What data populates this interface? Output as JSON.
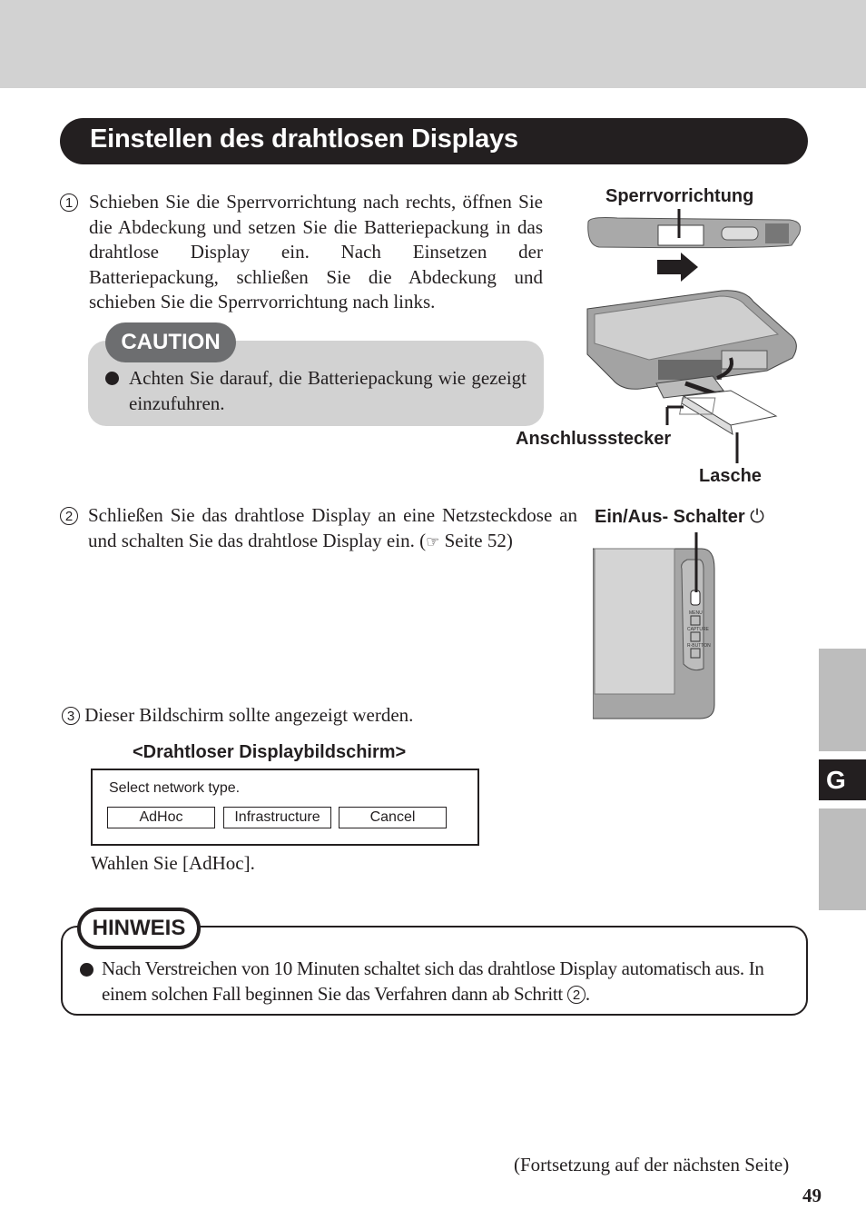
{
  "header": {
    "title": "Einstellen des drahtlosen Displays"
  },
  "steps": [
    {
      "number": "1",
      "text": "Schieben Sie die Sperrvorrichtung nach rechts, öffnen Sie die Abdeckung und setzen Sie die Batteriepackung in das drahtlose Display ein. Nach Einsetzen der Batteriepackung, schließen Sie die Abdeckung und schieben Sie die Sperrvorrichtung nach links."
    },
    {
      "number": "2",
      "text_before": "Schließen Sie das drahtlose Display an eine Netzsteckdose an und schalten Sie das drahtlose Display ein. (",
      "ref_icon": "pointing-hand-icon",
      "text_after": " Seite 52)"
    },
    {
      "number": "3",
      "text": "Dieser Bildschirm sollte angezeigt werden."
    }
  ],
  "caution": {
    "label": "CAUTION",
    "items": [
      "Achten Sie darauf, die Batteriepackung wie gezeigt einzufuhren."
    ]
  },
  "figure1": {
    "labels": {
      "lock": "Sperrvorrichtung",
      "connector": "Anschlussstecker",
      "tab": "Lasche"
    }
  },
  "figure2": {
    "label": "Ein/Aus- Schalter",
    "power_icon": "power-icon",
    "buttons": [
      "MENU",
      "CAPTURE",
      "R-BUTTON"
    ]
  },
  "screen": {
    "caption": "<Drahtloser Displaybildschirm>",
    "prompt": "Select network type.",
    "buttons": [
      "AdHoc",
      "Infrastructure",
      "Cancel"
    ]
  },
  "instruction": "Wahlen Sie [AdHoc].",
  "note": {
    "label": "HINWEIS",
    "text_before": "Nach Verstreichen von 10 Minuten schaltet sich das drahtlose Display automatisch aus. In einem solchen Fall beginnen Sie das Verfahren dann ab Schritt ",
    "step_ref": "2",
    "text_after": "."
  },
  "side_tab": {
    "letter": "G"
  },
  "footer": {
    "continuation": "(Fortsetzung auf der nächsten Seite)",
    "page_number": "49"
  },
  "colors": {
    "dark": "#231f20",
    "band": "#d2d2d2",
    "caution_bg": "#d2d2d2",
    "caution_tab": "#6d6e70",
    "side_tab": "#bdbdbd"
  }
}
